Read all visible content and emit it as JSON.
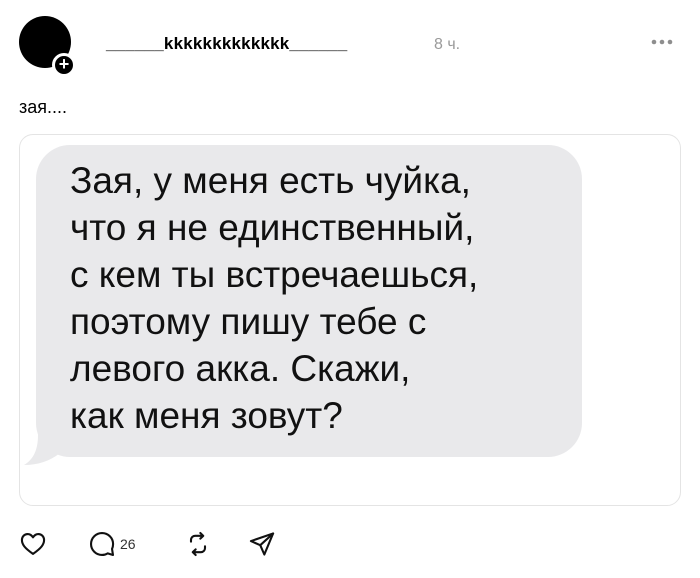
{
  "post": {
    "author": {
      "username": "______kkkkkkkkkkkkk______",
      "avatar_icon": "avatar-icon",
      "follow_icon": "plus-icon"
    },
    "time_ago": "8 ч.",
    "more_icon": "more-dots-icon",
    "caption": "зая....",
    "attachment": {
      "type": "message-bubble-screenshot",
      "bubble_color": "#e9e9eb",
      "message": "Зая, у меня есть чуйка,\nчто я не единственный,\nс кем ты встречаешься,\nпоэтому пишу тебе с\nлевого акка. Скажи,\nкак меня зовут?"
    },
    "actions": {
      "like_icon": "heart-icon",
      "reply_icon": "comment-icon",
      "reply_count": "26",
      "repost_icon": "repost-icon",
      "share_icon": "send-icon"
    }
  }
}
